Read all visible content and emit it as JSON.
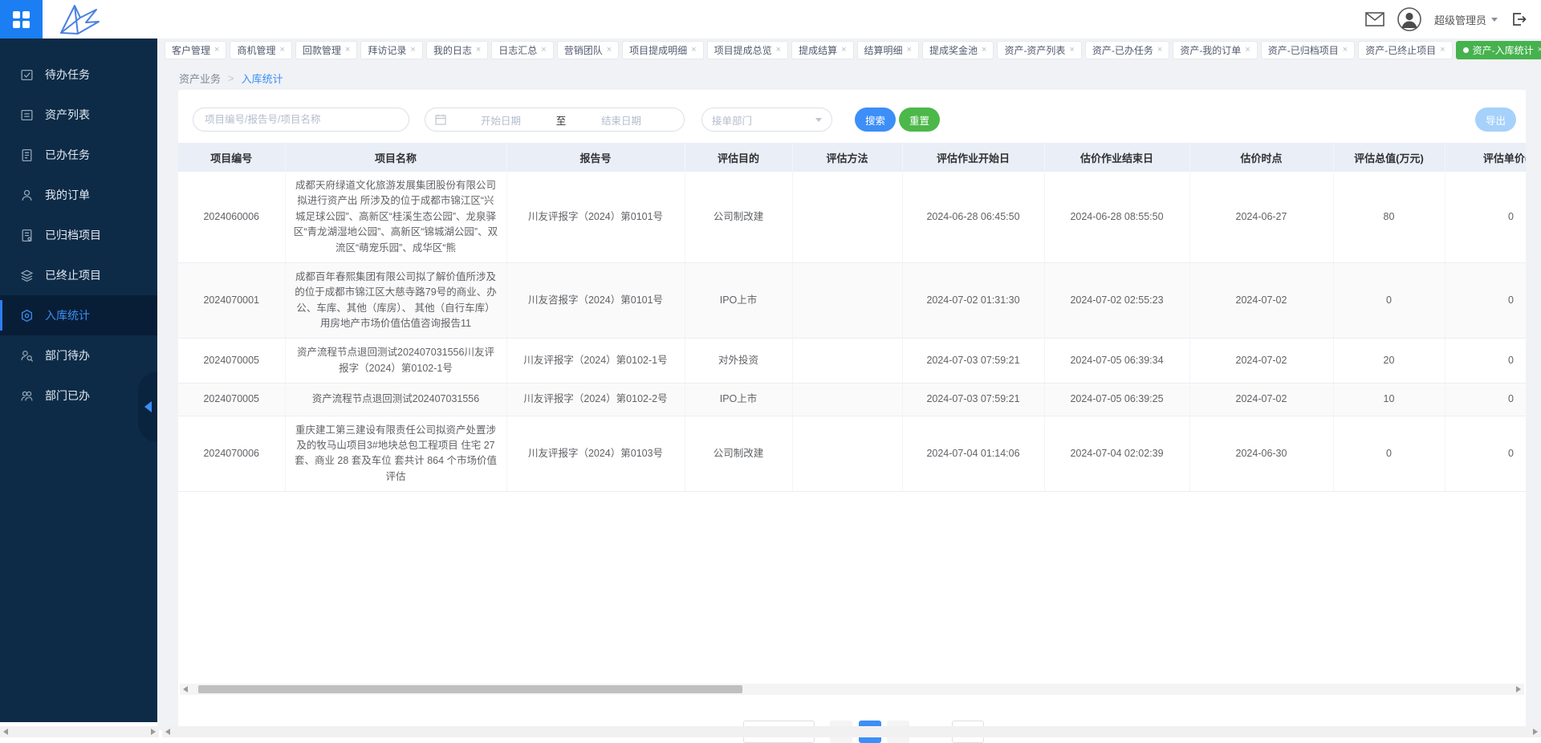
{
  "topbar": {
    "username": "超级管理员"
  },
  "sidebar": {
    "items": [
      {
        "label": "待办任务",
        "icon": "todo-check-icon"
      },
      {
        "label": "资产列表",
        "icon": "asset-list-icon"
      },
      {
        "label": "已办任务",
        "icon": "done-doc-icon"
      },
      {
        "label": "我的订单",
        "icon": "person-icon"
      },
      {
        "label": "已归档项目",
        "icon": "archive-doc-icon"
      },
      {
        "label": "已终止项目",
        "icon": "layers-icon"
      },
      {
        "label": "入库统计",
        "icon": "hexagon-stats-icon",
        "active": true
      },
      {
        "label": "部门待办",
        "icon": "dept-search-icon"
      },
      {
        "label": "部门已办",
        "icon": "dept-people-icon"
      }
    ]
  },
  "tabs": [
    {
      "label": "客户管理"
    },
    {
      "label": "商机管理"
    },
    {
      "label": "回款管理"
    },
    {
      "label": "拜访记录"
    },
    {
      "label": "我的日志"
    },
    {
      "label": "日志汇总"
    },
    {
      "label": "营销团队"
    },
    {
      "label": "项目提成明细"
    },
    {
      "label": "项目提成总览"
    },
    {
      "label": "提成结算"
    },
    {
      "label": "结算明细"
    },
    {
      "label": "提成奖金池"
    },
    {
      "label": "资产-资产列表"
    },
    {
      "label": "资产-已办任务"
    },
    {
      "label": "资产-我的订单"
    },
    {
      "label": "资产-已归档项目"
    },
    {
      "label": "资产-已终止项目"
    },
    {
      "label": "资产-入库统计",
      "active": true
    }
  ],
  "breadcrumb": {
    "parent": "资产业务",
    "separator": ">",
    "current": "入库统计"
  },
  "filters": {
    "keyword_placeholder": "项目编号/报告号/项目名称",
    "start_placeholder": "开始日期",
    "range_separator": "至",
    "end_placeholder": "结束日期",
    "dept_placeholder": "接单部门",
    "search_label": "搜索",
    "reset_label": "重置",
    "export_label": "导出"
  },
  "table": {
    "columns": [
      "项目编号",
      "项目名称",
      "报告号",
      "评估目的",
      "评估方法",
      "评估作业开始日",
      "估价作业结束日",
      "估价时点",
      "评估总值(万元)",
      "评估单价(元"
    ],
    "rows": [
      {
        "no": "2024060006",
        "name": "成都天府绿道文化旅游发展集团股份有限公司拟进行资产出 所涉及的位于成都市锦江区“兴城足球公园”、高新区“桂溪生态公园”、龙泉驿区“青龙湖湿地公园”、高新区“锦城湖公园”、双流区“萌宠乐园”、成华区“熊",
        "report": "川友评报字（2024）第0101号",
        "purpose": "公司制改建",
        "method": "",
        "start": "2024-06-28 06:45:50",
        "end": "2024-06-28 08:55:50",
        "point": "2024-06-27",
        "total": "80",
        "unit": "0"
      },
      {
        "no": "2024070001",
        "name": "成都百年春熙集团有限公司拟了解价值所涉及的位于成都市锦江区大慈寺路79号的商业、办公、车库、其他（库房）、 其他（自行车库）用房地产市场价值估值咨询报告11",
        "report": "川友咨报字（2024）第0101号",
        "purpose": "IPO上市",
        "method": "",
        "start": "2024-07-02 01:31:30",
        "end": "2024-07-02 02:55:23",
        "point": "2024-07-02",
        "total": "0",
        "unit": "0"
      },
      {
        "no": "2024070005",
        "name": "资产流程节点退回测试202407031556川友评报字（2024）第0102-1号",
        "report": "川友评报字（2024）第0102-1号",
        "purpose": "对外投资",
        "method": "",
        "start": "2024-07-03 07:59:21",
        "end": "2024-07-05 06:39:34",
        "point": "2024-07-02",
        "total": "20",
        "unit": "0"
      },
      {
        "no": "2024070005",
        "name": "资产流程节点退回测试202407031556",
        "report": "川友评报字（2024）第0102-2号",
        "purpose": "IPO上市",
        "method": "",
        "start": "2024-07-03 07:59:21",
        "end": "2024-07-05 06:39:25",
        "point": "2024-07-02",
        "total": "10",
        "unit": "0"
      },
      {
        "no": "2024070006",
        "name": "重庆建工第三建设有限责任公司拟资产处置涉及的牧马山项目3#地块总包工程项目 住宅 27 套、商业 28 套及车位 套共计 864 个市场价值评估",
        "report": "川友评报字（2024）第0103号",
        "purpose": "公司制改建",
        "method": "",
        "start": "2024-07-04 01:14:06",
        "end": "2024-07-04 02:02:39",
        "point": "2024-06-30",
        "total": "0",
        "unit": "0"
      }
    ]
  },
  "colors": {
    "accent_blue": "#3d8ef7",
    "accent_green": "#46b24e",
    "sidebar_navy": "#0d2b47",
    "header_bg": "#e9eef7"
  }
}
